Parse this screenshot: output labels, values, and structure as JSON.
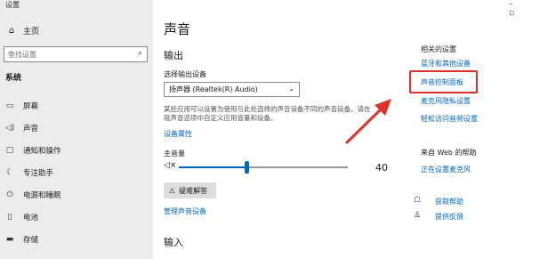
{
  "app_title": "设置",
  "sidebar": {
    "home": "主页",
    "search_placeholder": "查找设置",
    "section": "系统",
    "items": [
      {
        "label": "屏幕",
        "icon": "monitor-icon"
      },
      {
        "label": "声音",
        "icon": "speaker-icon"
      },
      {
        "label": "通知和操作",
        "icon": "notification-icon"
      },
      {
        "label": "专注助手",
        "icon": "moon-icon"
      },
      {
        "label": "电源和睡眠",
        "icon": "power-icon"
      },
      {
        "label": "电池",
        "icon": "battery-icon"
      },
      {
        "label": "存储",
        "icon": "storage-icon"
      }
    ]
  },
  "main": {
    "title": "声音",
    "output_heading": "输出",
    "output_device_label": "选择输出设备",
    "output_device_value": "扬声器 (Realtek(R) Audio)",
    "description_line1": "某些应用可以设置为使用与此处选择的声音设备不同的声音设备。请在",
    "description_line2": "吸声音选项中自定义应用音量和设备。",
    "device_properties": "设备属性",
    "master_volume_label": "主音量",
    "volume": 40,
    "volume_text": "40",
    "troubleshoot": "疑难解答",
    "manage_devices": "管理声音设备",
    "input_heading": "输入"
  },
  "related": {
    "heading": "相关的设置",
    "links": [
      "蓝牙和其他设备",
      "声音控制面板",
      "麦克风隐私设置",
      "轻松访问音频设置"
    ],
    "help_heading": "来自 Web 的帮助",
    "help_link": "正在设置麦克风",
    "get_help": "获取帮助",
    "feedback": "提供反馈"
  },
  "colors": {
    "accent": "#0067c0",
    "highlight_border": "#e0302a",
    "sidebar_bg": "#ececec"
  }
}
